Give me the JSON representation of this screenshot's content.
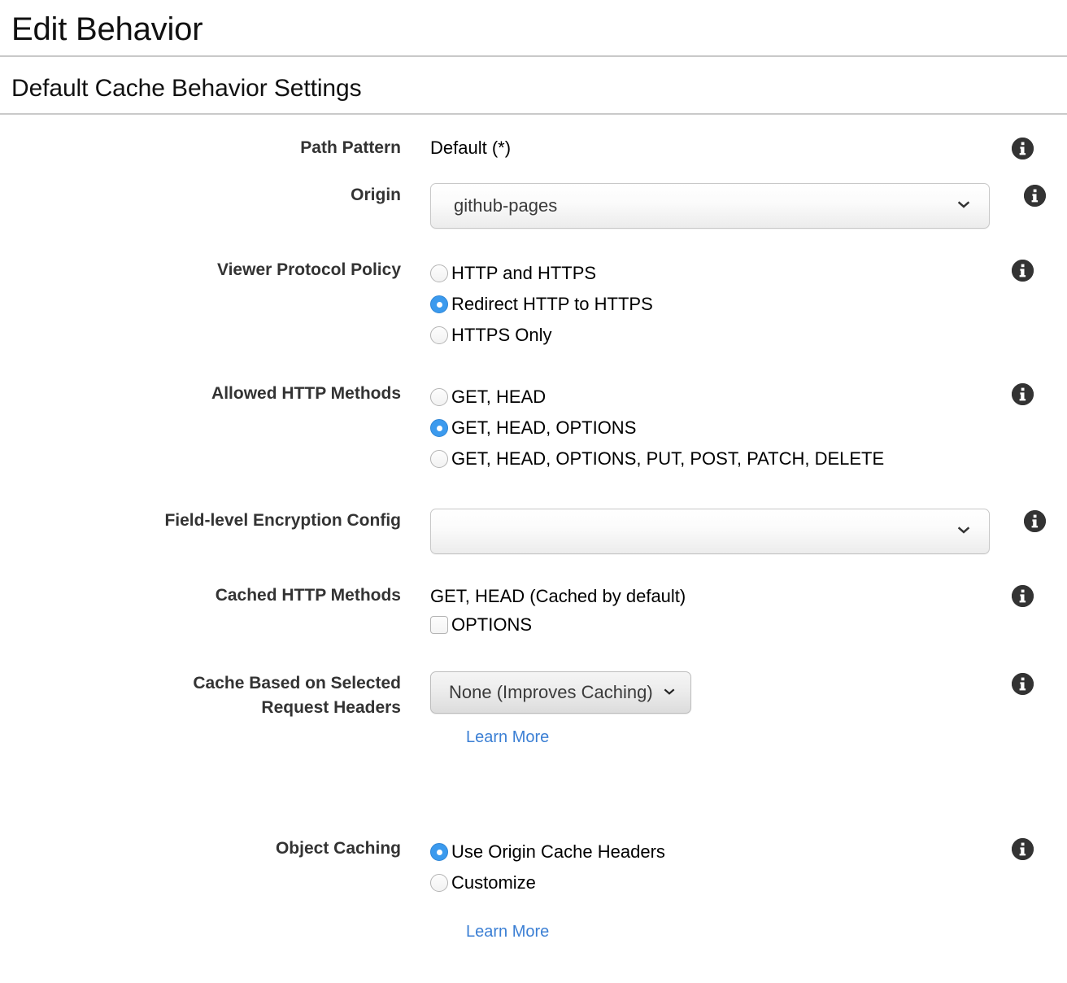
{
  "header": {
    "page_title": "Edit Behavior",
    "section_title": "Default Cache Behavior Settings"
  },
  "colors": {
    "accent_blue": "#3b9aee",
    "link_blue": "#3b7fd4",
    "label_gray": "#333333",
    "rule_gray": "#c9c9c9",
    "info_icon_bg": "#333333"
  },
  "icons": {
    "info": "info-icon",
    "chevron_down": "chevron-down-icon"
  },
  "fields": {
    "path_pattern": {
      "label": "Path Pattern",
      "value": "Default (*)"
    },
    "origin": {
      "label": "Origin",
      "value": "github-pages"
    },
    "viewer_protocol_policy": {
      "label": "Viewer Protocol Policy",
      "options": [
        {
          "label": "HTTP and HTTPS",
          "selected": false
        },
        {
          "label": "Redirect HTTP to HTTPS",
          "selected": true
        },
        {
          "label": "HTTPS Only",
          "selected": false
        }
      ]
    },
    "allowed_http_methods": {
      "label": "Allowed HTTP Methods",
      "options": [
        {
          "label": "GET, HEAD",
          "selected": false
        },
        {
          "label": "GET, HEAD, OPTIONS",
          "selected": true
        },
        {
          "label": "GET, HEAD, OPTIONS, PUT, POST, PATCH, DELETE",
          "selected": false
        }
      ]
    },
    "field_level_encryption_config": {
      "label": "Field-level Encryption Config",
      "value": ""
    },
    "cached_http_methods": {
      "label": "Cached HTTP Methods",
      "note": "GET, HEAD (Cached by default)",
      "checkbox_label": "OPTIONS",
      "checkbox_checked": false
    },
    "cache_based_on_selected_request_headers": {
      "label_line1": "Cache Based on Selected",
      "label_line2": "Request Headers",
      "value": "None (Improves Caching)",
      "learn_more": "Learn More"
    },
    "object_caching": {
      "label": "Object Caching",
      "options": [
        {
          "label": "Use Origin Cache Headers",
          "selected": true
        },
        {
          "label": "Customize",
          "selected": false
        }
      ],
      "learn_more": "Learn More"
    }
  }
}
